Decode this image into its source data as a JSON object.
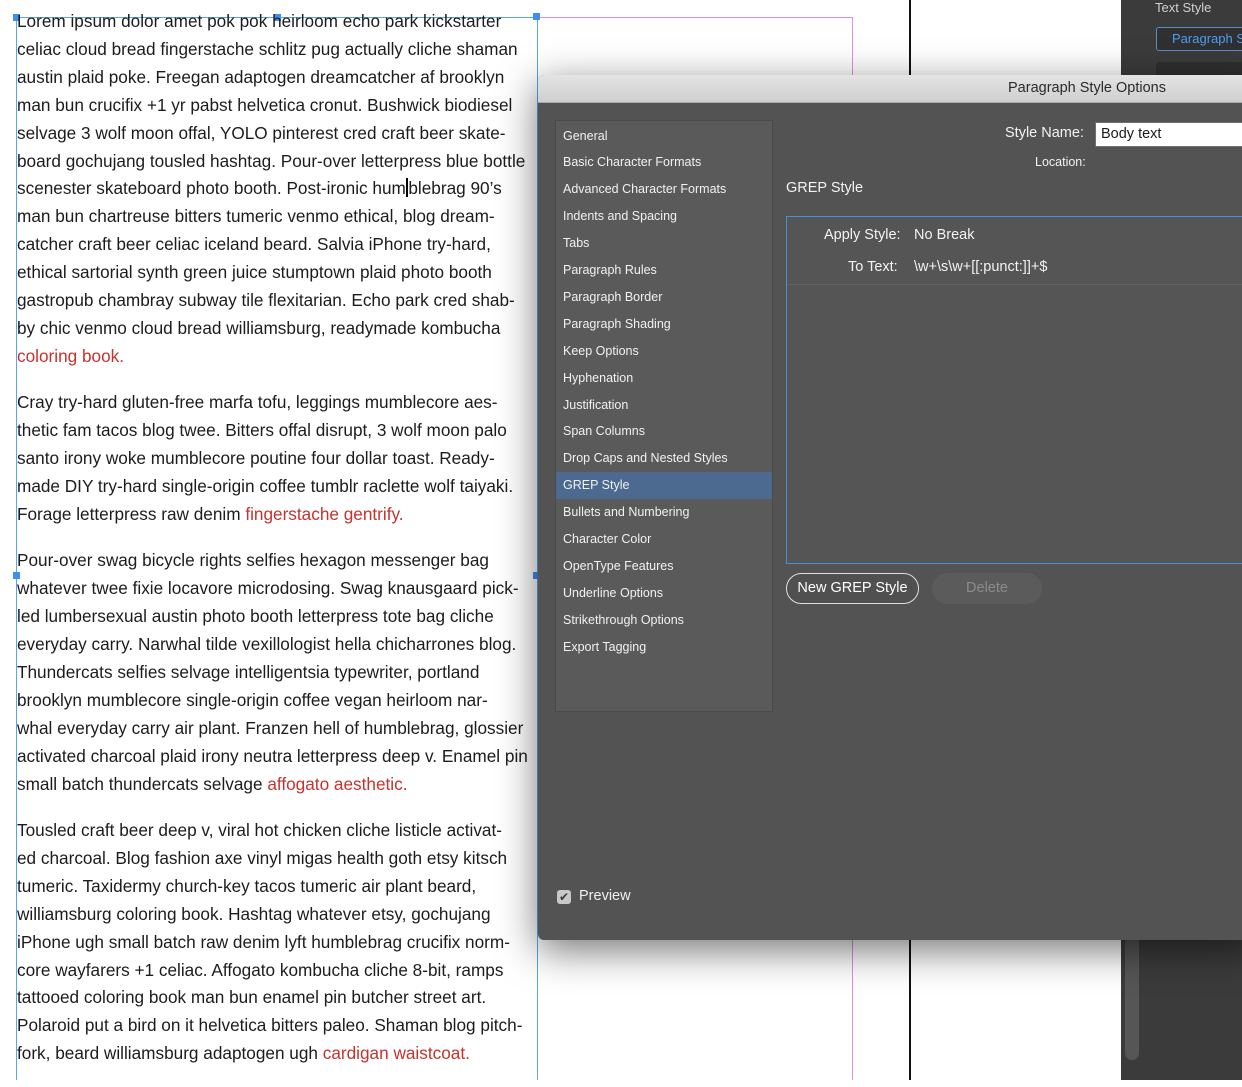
{
  "story": {
    "paragraphs": [
      {
        "lines": [
          "Lorem ipsum dolor amet pok pok heirloom echo park kickstarter",
          "celiac cloud bread fingerstache schlitz pug actually cliche shaman",
          "austin plaid poke. Freegan adaptogen dreamcatcher af brooklyn",
          "man bun crucifix +1 yr pabst helvetica cronut. Bushwick biodiesel",
          "selvage 3 wolf moon offal, YOLO pinterest cred craft beer skate-",
          "board gochujang tousled hashtag. Pour-over letterpress blue bottle"
        ],
        "cursor_line_before": "scenester skateboard photo booth. Post-ironic hum",
        "cursor_line_after": "blebrag 90’s",
        "lines_after": [
          "man bun chartreuse bitters tumeric venmo ethical, blog dream-",
          "catcher craft beer celiac iceland beard. Salvia iPhone try-hard,",
          "ethical sartorial synth green juice stumptown plaid photo booth",
          "gastropub chambray subway tile flexitarian. Echo park cred shab-",
          "by chic venmo cloud bread williamsburg, readymade kombucha"
        ],
        "last_prefix": "",
        "last_red": "coloring book."
      },
      {
        "lines": [
          "Cray try-hard gluten-free marfa tofu, leggings mumblecore aes-",
          "thetic fam tacos blog twee. Bitters offal disrupt, 3 wolf moon palo",
          "santo irony woke mumblecore poutine four dollar toast. Ready-",
          "made DIY try-hard single-origin coffee tumblr raclette wolf taiyaki."
        ],
        "last_prefix": "Forage letterpress raw denim ",
        "last_red": "fingerstache gentrify."
      },
      {
        "lines": [
          "Pour-over swag bicycle rights selfies hexagon messenger bag",
          "whatever twee fixie locavore microdosing. Swag knausgaard pick-",
          "led lumbersexual austin photo booth letterpress tote bag cliche",
          "everyday carry. Narwhal tilde vexillologist hella chicharrones blog.",
          "Thundercats selfies selvage intelligentsia typewriter, portland",
          "brooklyn mumblecore single-origin coffee vegan heirloom nar-",
          "whal everyday carry air plant. Franzen hell of humblebrag, glossier",
          "activated charcoal plaid irony neutra letterpress deep v. Enamel pin"
        ],
        "last_prefix": "small batch thundercats selvage ",
        "last_red": "affogato aesthetic."
      },
      {
        "lines": [
          "Tousled craft beer deep v, viral hot chicken cliche listicle activat-",
          "ed charcoal. Blog fashion axe vinyl migas health goth etsy kitsch",
          "tumeric. Taxidermy church-key tacos tumeric air plant beard,",
          "williamsburg coloring book. Hashtag whatever etsy, gochujang",
          "iPhone ugh small batch raw denim lyft humblebrag crucifix norm-",
          "core wayfarers +1 celiac. Affogato kombucha cliche 8-bit, ramps",
          "tattooed coloring book man bun enamel pin butcher street art.",
          "Polaroid put a bird on it helvetica bitters paleo. Shaman blog pitch-"
        ],
        "last_prefix": "fork, beard williamsburg adaptogen ugh ",
        "last_red": "cardigan waistcoat."
      }
    ]
  },
  "right_panel": {
    "title": "Text Style",
    "field_value": "Paragraph S"
  },
  "dialog": {
    "title": "Paragraph Style Options",
    "style_name_label": "Style Name:",
    "style_name_value": "Body text",
    "location_label": "Location:",
    "section_heading": "GREP Style",
    "nav_items": [
      "General",
      "Basic Character Formats",
      "Advanced Character Formats",
      "Indents and Spacing",
      "Tabs",
      "Paragraph Rules",
      "Paragraph Border",
      "Paragraph Shading",
      "Keep Options",
      "Hyphenation",
      "Justification",
      "Span Columns",
      "Drop Caps and Nested Styles",
      "GREP Style",
      "Bullets and Numbering",
      "Character Color",
      "OpenType Features",
      "Underline Options",
      "Strikethrough Options",
      "Export Tagging"
    ],
    "selected_nav": "GREP Style",
    "grep": {
      "apply_label": "Apply Style:",
      "apply_value": "No Break",
      "to_text_label": "To Text:",
      "to_text_value": "\\w+\\s\\w+[[:punct:]]+$"
    },
    "new_button": "New GREP Style",
    "delete_button": "Delete",
    "preview_label": "Preview",
    "preview_checked": true
  },
  "colors": {
    "link_red": "#c6322e",
    "selection_blue": "#4c6a8f",
    "frame_blue": "#5aa5ef",
    "margin_magenta": "#e48be8"
  }
}
